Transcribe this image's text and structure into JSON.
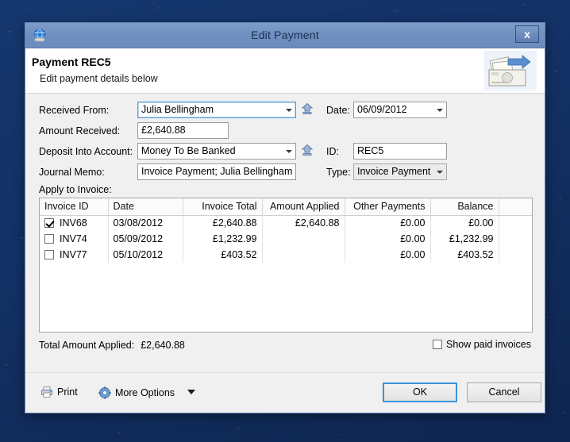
{
  "window": {
    "title": "Edit Payment",
    "icon": "app-globe-icon",
    "close_label": "x"
  },
  "header": {
    "title": "Payment REC5",
    "subtitle": "Edit payment details below",
    "art_icon": "money-transfer-icon"
  },
  "form": {
    "received_from": {
      "label": "Received From:",
      "value": "Julia Bellingham"
    },
    "amount_received": {
      "label": "Amount Received:",
      "value": "£2,640.88"
    },
    "deposit_into_account": {
      "label": "Deposit Into Account:",
      "value": "Money To Be Banked"
    },
    "journal_memo": {
      "label": "Journal Memo:",
      "value": "Invoice Payment; Julia Bellingham"
    },
    "date": {
      "label": "Date:",
      "value": "06/09/2012"
    },
    "id": {
      "label": "ID:",
      "value": "REC5"
    },
    "type": {
      "label": "Type:",
      "value": "Invoice Payment"
    }
  },
  "invoices": {
    "section_label": "Apply to Invoice:",
    "columns": [
      "Invoice ID",
      "Date",
      "Invoice Total",
      "Amount Applied",
      "Other Payments",
      "Balance",
      ""
    ],
    "rows": [
      {
        "checked": true,
        "invoice_id": "INV68",
        "date": "03/08/2012",
        "invoice_total": "£2,640.88",
        "amount_applied": "£2,640.88",
        "other_payments": "£0.00",
        "balance": "£0.00"
      },
      {
        "checked": false,
        "invoice_id": "INV74",
        "date": "05/09/2012",
        "invoice_total": "£1,232.99",
        "amount_applied": "",
        "other_payments": "£0.00",
        "balance": "£1,232.99"
      },
      {
        "checked": false,
        "invoice_id": "INV77",
        "date": "05/10/2012",
        "invoice_total": "£403.52",
        "amount_applied": "",
        "other_payments": "£0.00",
        "balance": "£403.52"
      }
    ]
  },
  "summary": {
    "total_label": "Total Amount Applied:",
    "total_value": "£2,640.88",
    "show_paid_label": "Show paid invoices",
    "show_paid_checked": false
  },
  "footer": {
    "print_label": "Print",
    "more_options_label": "More Options",
    "ok_label": "OK",
    "cancel_label": "Cancel"
  },
  "colors": {
    "titlebar": "#6e8fc0",
    "accent": "#3b93d9",
    "desktop": "#14336b"
  }
}
